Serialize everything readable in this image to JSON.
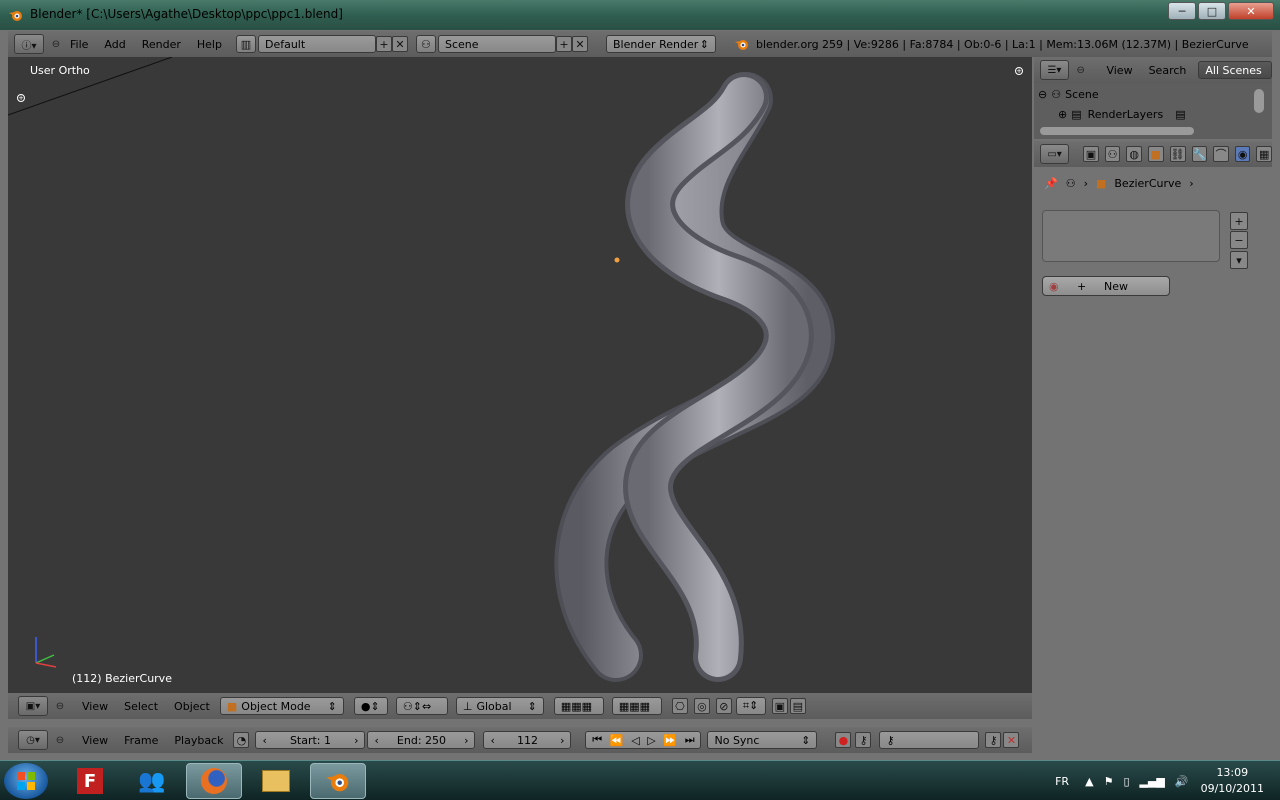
{
  "window": {
    "title": "Blender* [C:\\Users\\Agathe\\Desktop\\ppc\\ppc1.blend]",
    "minimize": "─",
    "maximize": "□",
    "close": "✕"
  },
  "info_header": {
    "menus": [
      "File",
      "Add",
      "Render",
      "Help"
    ],
    "screen_layout": "Default",
    "scene": "Scene",
    "render_engine": "Blender Render",
    "stats": "blender.org 259 | Ve:9286 | Fa:8784 | Ob:0-6 | La:1 | Mem:13.06M (12.37M) | BezierCurve"
  },
  "viewport": {
    "view_name": "User Ortho",
    "object_info": "(112) BezierCurve"
  },
  "view3d_header": {
    "menus": [
      "View",
      "Select",
      "Object"
    ],
    "mode": "Object Mode",
    "orientation": "Global"
  },
  "timeline": {
    "menus": [
      "View",
      "Frame",
      "Playback"
    ],
    "start": "Start: 1",
    "end": "End: 250",
    "current_frame": "112",
    "sync": "No Sync"
  },
  "outliner": {
    "menus": [
      "View",
      "Search"
    ],
    "filter": "All Scenes",
    "items": [
      "Scene",
      "RenderLayers"
    ]
  },
  "properties": {
    "breadcrumb_object": "BezierCurve",
    "new_button": "New"
  },
  "taskbar": {
    "language": "FR",
    "time": "13:09",
    "date": "09/10/2011"
  },
  "colors": {
    "viewport_bg": "#393939",
    "panel_bg": "#737373",
    "header_bg": "#666666",
    "mesh": "#8a8a92"
  }
}
